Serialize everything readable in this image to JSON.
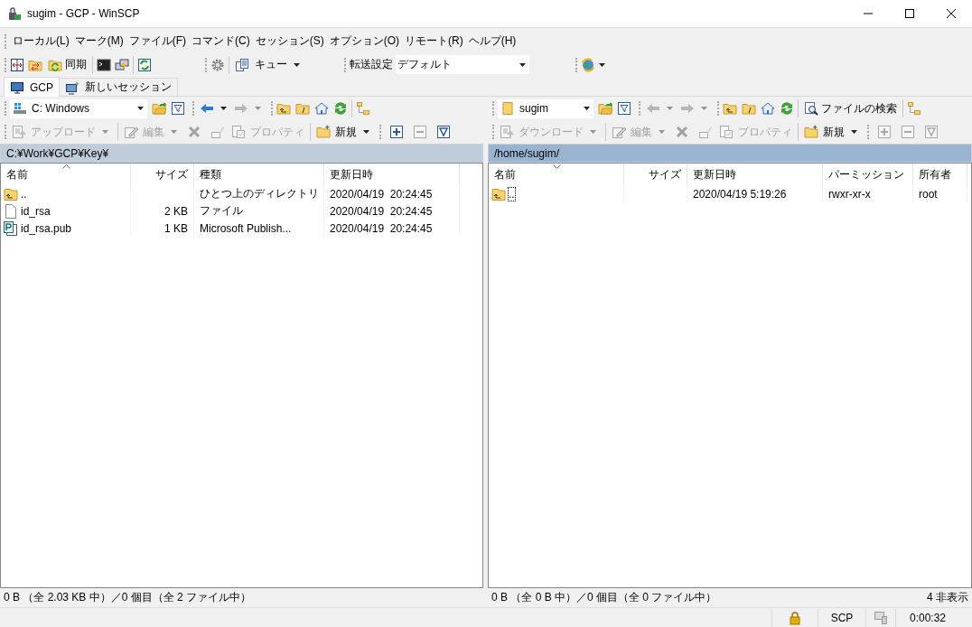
{
  "window": {
    "title": "sugim - GCP - WinSCP"
  },
  "menu": [
    "ローカル(L)",
    "マーク(M)",
    "ファイル(F)",
    "コマンド(C)",
    "セッション(S)",
    "オプション(O)",
    "リモート(R)",
    "ヘルプ(H)"
  ],
  "toolbar": {
    "sync_label": "同期",
    "queue_label": "キュー",
    "transfer_settings_label": "転送設定",
    "transfer_settings_value": "デフォルト"
  },
  "session_tabs": [
    {
      "label": "GCP",
      "selected": true
    },
    {
      "label": "新しいセッション",
      "selected": false
    }
  ],
  "panels": [
    {
      "kind": "local",
      "location": "C: Windows",
      "back_enabled": true,
      "forward_enabled": false,
      "actions": [
        {
          "kind": "labeled",
          "label": "アップロード",
          "disabled": true,
          "dropdown": true
        },
        {
          "kind": "labeled",
          "label": "編集",
          "disabled": true,
          "dropdown": true
        },
        {
          "kind": "icon",
          "disabled": true
        },
        {
          "kind": "icon",
          "disabled": true
        },
        {
          "kind": "labeled",
          "label": "プロパティ",
          "disabled": true,
          "dropdown": false
        },
        {
          "kind": "labeled",
          "label": "新規",
          "disabled": false,
          "dropdown": true
        },
        {
          "kind": "icon",
          "disabled": false
        },
        {
          "kind": "icon",
          "disabled": true
        },
        {
          "kind": "icon",
          "disabled": false
        }
      ],
      "path": "C:¥Work¥GCP¥Key¥",
      "active": false,
      "sort_descending": false,
      "columns": [
        "名前",
        "サイズ",
        "種類",
        "更新日時"
      ],
      "rows": [
        {
          "kind": "parent",
          "focused": false,
          "cells": [
            "..",
            "",
            "ひとつ上のディレクトリ",
            "2020/04/19  20:24:45"
          ]
        },
        {
          "kind": "file",
          "focused": false,
          "cells": [
            "id_rsa",
            "2 KB",
            "ファイル",
            "2020/04/19  20:24:45"
          ]
        },
        {
          "kind": "publisher",
          "focused": false,
          "cells": [
            "id_rsa.pub",
            "1 KB",
            "Microsoft Publish...",
            "2020/04/19  20:24:45"
          ]
        }
      ],
      "status": "0 B （全 2.03 KB 中）／0 個目（全 2 ファイル中）"
    },
    {
      "kind": "remote",
      "location": "sugim",
      "back_enabled": false,
      "forward_enabled": false,
      "find_label": "ファイルの検索",
      "actions": [
        {
          "kind": "labeled",
          "label": "ダウンロード",
          "disabled": true,
          "dropdown": true
        },
        {
          "kind": "labeled",
          "label": "編集",
          "disabled": true,
          "dropdown": true
        },
        {
          "kind": "icon",
          "disabled": true
        },
        {
          "kind": "icon",
          "disabled": true
        },
        {
          "kind": "labeled",
          "label": "プロパティ",
          "disabled": true,
          "dropdown": false
        },
        {
          "kind": "labeled",
          "label": "新規",
          "disabled": false,
          "dropdown": true
        },
        {
          "kind": "icon",
          "disabled": true
        },
        {
          "kind": "icon",
          "disabled": true
        },
        {
          "kind": "icon",
          "disabled": true
        }
      ],
      "path": "/home/sugim/",
      "active": true,
      "sort_descending": true,
      "columns": [
        "名前",
        "サイズ",
        "更新日時",
        "パーミッション",
        "所有者"
      ],
      "rows": [
        {
          "kind": "parent",
          "focused": true,
          "cells": [
            "..",
            "",
            "2020/04/19 5:19:26",
            "rwxr-xr-x",
            "root"
          ]
        }
      ],
      "status": "0 B （全 0 B 中）／0 個目（全 0 ファイル中）",
      "status_extra": "4 非表示"
    }
  ],
  "status_bar": {
    "protocol": "SCP",
    "elapsed": "0:00:32"
  }
}
